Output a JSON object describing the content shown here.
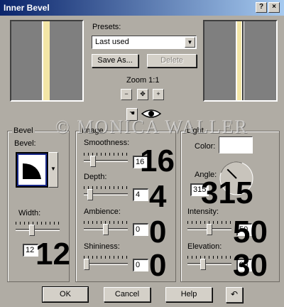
{
  "window": {
    "title": "Inner Bevel",
    "help_glyph": "?",
    "close_glyph": "×"
  },
  "colors": {
    "title_bar": "#0a246a",
    "preview_gray": "#7f7f7f",
    "preview_stripe": "#f3e6a6",
    "dialog": "#b0aca4"
  },
  "presets": {
    "label": "Presets:",
    "value": "Last used",
    "save_as": "Save As...",
    "delete": "Delete"
  },
  "zoom": {
    "label": "Zoom 1:1",
    "tools": [
      "zoom-out-icon",
      "pan-icon",
      "zoom-in-icon",
      "hand-icon",
      "eye-icon"
    ]
  },
  "watermark": "© MONICA WALLER",
  "bevel": {
    "legend": "Bevel",
    "bevel_label": "Bevel:",
    "width_label": "Width:",
    "width_value": "12",
    "width_fraction": 0.35
  },
  "image": {
    "legend": "Image",
    "smoothness": {
      "label": "Smoothness:",
      "value": "16",
      "fraction": 0.16
    },
    "depth": {
      "label": "Depth:",
      "value": "4",
      "fraction": 0.1
    },
    "ambience": {
      "label": "Ambience:",
      "value": "0",
      "fraction": 0.5
    },
    "shininess": {
      "label": "Shininess:",
      "value": "0",
      "fraction": 0.0
    }
  },
  "light": {
    "legend": "Light",
    "color_label": "Color:",
    "color_value": "#ffffff",
    "angle": {
      "label": "Angle:",
      "value": "315",
      "degrees": 315
    },
    "intensity": {
      "label": "Intensity:",
      "value": "50",
      "fraction": 0.5
    },
    "elevation": {
      "label": "Elevation:",
      "value": "30",
      "fraction": 0.33
    }
  },
  "annotations": {
    "smoothness": "16",
    "depth": "4",
    "ambience": "0",
    "shininess": "0",
    "width": "12",
    "angle": "315",
    "intensity": "50",
    "elevation": "30"
  },
  "buttons": {
    "ok": "OK",
    "cancel": "Cancel",
    "help": "Help"
  }
}
